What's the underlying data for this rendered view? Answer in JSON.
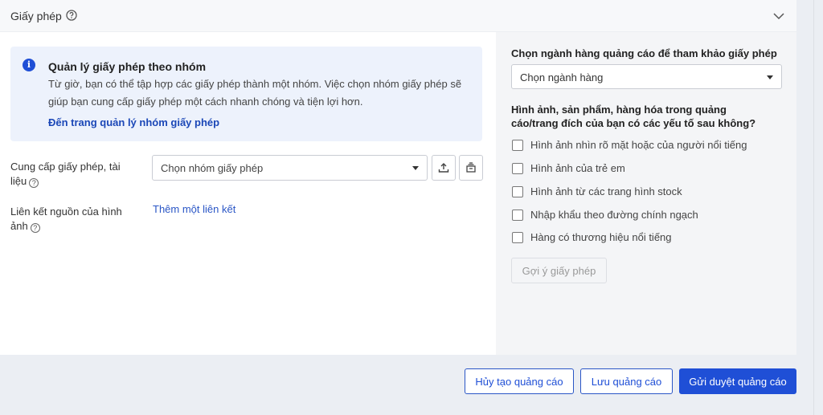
{
  "section": {
    "title": "Giấy phép"
  },
  "info": {
    "title": "Quản lý giấy phép theo nhóm",
    "text": "Từ giờ, bạn có thể tập hợp các giấy phép thành một nhóm. Việc chọn nhóm giấy phép sẽ giúp bạn cung cấp giấy phép một cách nhanh chóng và tiện lợi hơn.",
    "link": "Đến trang quản lý nhóm giấy phép"
  },
  "form": {
    "provide_label": "Cung cấp giấy phép, tài liệu",
    "group_select_value": "Chọn nhóm giấy phép",
    "source_label": "Liên kết nguồn của hình ảnh",
    "add_link": "Thêm một liên kết"
  },
  "right": {
    "title": "Chọn ngành hàng quảng cáo để tham khảo giấy phép",
    "category_value": "Chọn ngành hàng",
    "question": "Hình ảnh, sản phẩm, hàng hóa trong quảng cáo/trang đích của bạn có các yếu tố sau không?",
    "options": [
      "Hình ảnh nhìn rõ mặt hoặc của người nổi tiếng",
      "Hình ảnh của trẻ em",
      "Hình ảnh từ các trang hình stock",
      "Nhập khẩu theo đường chính ngạch",
      "Hàng có thương hiệu nổi tiếng"
    ],
    "suggest_button": "Gợi ý giấy phép"
  },
  "footer": {
    "cancel": "Hủy tạo quảng cáo",
    "save": "Lưu quảng cáo",
    "submit": "Gửi duyệt quảng cáo"
  },
  "colors": {
    "primary": "#1f4fd6",
    "info_bg": "#edf2fc",
    "panel_bg": "#f4f5f7",
    "page_bg": "#ebeef3"
  },
  "icons": {
    "help": "help-circle-icon",
    "collapse": "chevron-down-icon",
    "info": "info-icon",
    "upload": "upload-icon",
    "library": "library-icon"
  }
}
